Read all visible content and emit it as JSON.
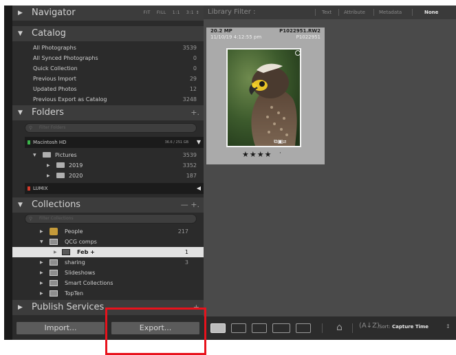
{
  "navigator": {
    "title": "Navigator",
    "options": [
      "FIT",
      "FILL",
      "1:1",
      "3:1 ↕"
    ]
  },
  "catalog": {
    "title": "Catalog",
    "items": [
      {
        "label": "All Photographs",
        "count": "3539"
      },
      {
        "label": "All Synced Photographs",
        "count": "0"
      },
      {
        "label": "Quick Collection",
        "count": "0"
      },
      {
        "label": "Previous Import",
        "count": "29"
      },
      {
        "label": "Updated Photos",
        "count": "12"
      },
      {
        "label": "Previous Export as Catalog",
        "count": "3248"
      }
    ]
  },
  "folders": {
    "title": "Folders",
    "add": "+.",
    "filter_placeholder": "Filter Folders",
    "volume": {
      "name": "Macintosh HD",
      "size": "36.6 / 251 GB",
      "led_color": "#3ab54a"
    },
    "items": [
      {
        "label": "Pictures",
        "count": "3539"
      },
      {
        "label": "2019",
        "count": "3352"
      },
      {
        "label": "2020",
        "count": "187"
      }
    ],
    "volume2": {
      "name": "LUMIX",
      "led_color": "#d23a2a"
    }
  },
  "collections": {
    "title": "Collections",
    "controls": "—  +.",
    "filter_placeholder": "Filter Collections",
    "items": [
      {
        "label": "People",
        "count": "217"
      },
      {
        "label": "QCG comps",
        "count": ""
      },
      {
        "label": "Feb +",
        "count": "1"
      },
      {
        "label": "sharing",
        "count": "3"
      },
      {
        "label": "Slideshows",
        "count": ""
      },
      {
        "label": "Smart Collections",
        "count": ""
      },
      {
        "label": "TopTen",
        "count": ""
      }
    ]
  },
  "publish": {
    "title": "Publish Services",
    "add": "+"
  },
  "buttons": {
    "import": "Import...",
    "export": "Export..."
  },
  "filter": {
    "title": "Library Filter :",
    "options": [
      "Text",
      "Attribute",
      "Metadata",
      "None"
    ],
    "active": "None"
  },
  "photo": {
    "megapixels": "20.2 MP",
    "filename": "P1022951.RW2",
    "date": "11/10/19 4:12:55 pm",
    "number": "P1022951",
    "rating": "★★★★",
    "dot": "·"
  },
  "toolbar": {
    "sort_label": "Sort:",
    "sort_value": "Capture Time",
    "sort_arrow": "↕"
  },
  "colors": {
    "highlight": "#e8121c",
    "selected_row": "#e2e2e2"
  }
}
